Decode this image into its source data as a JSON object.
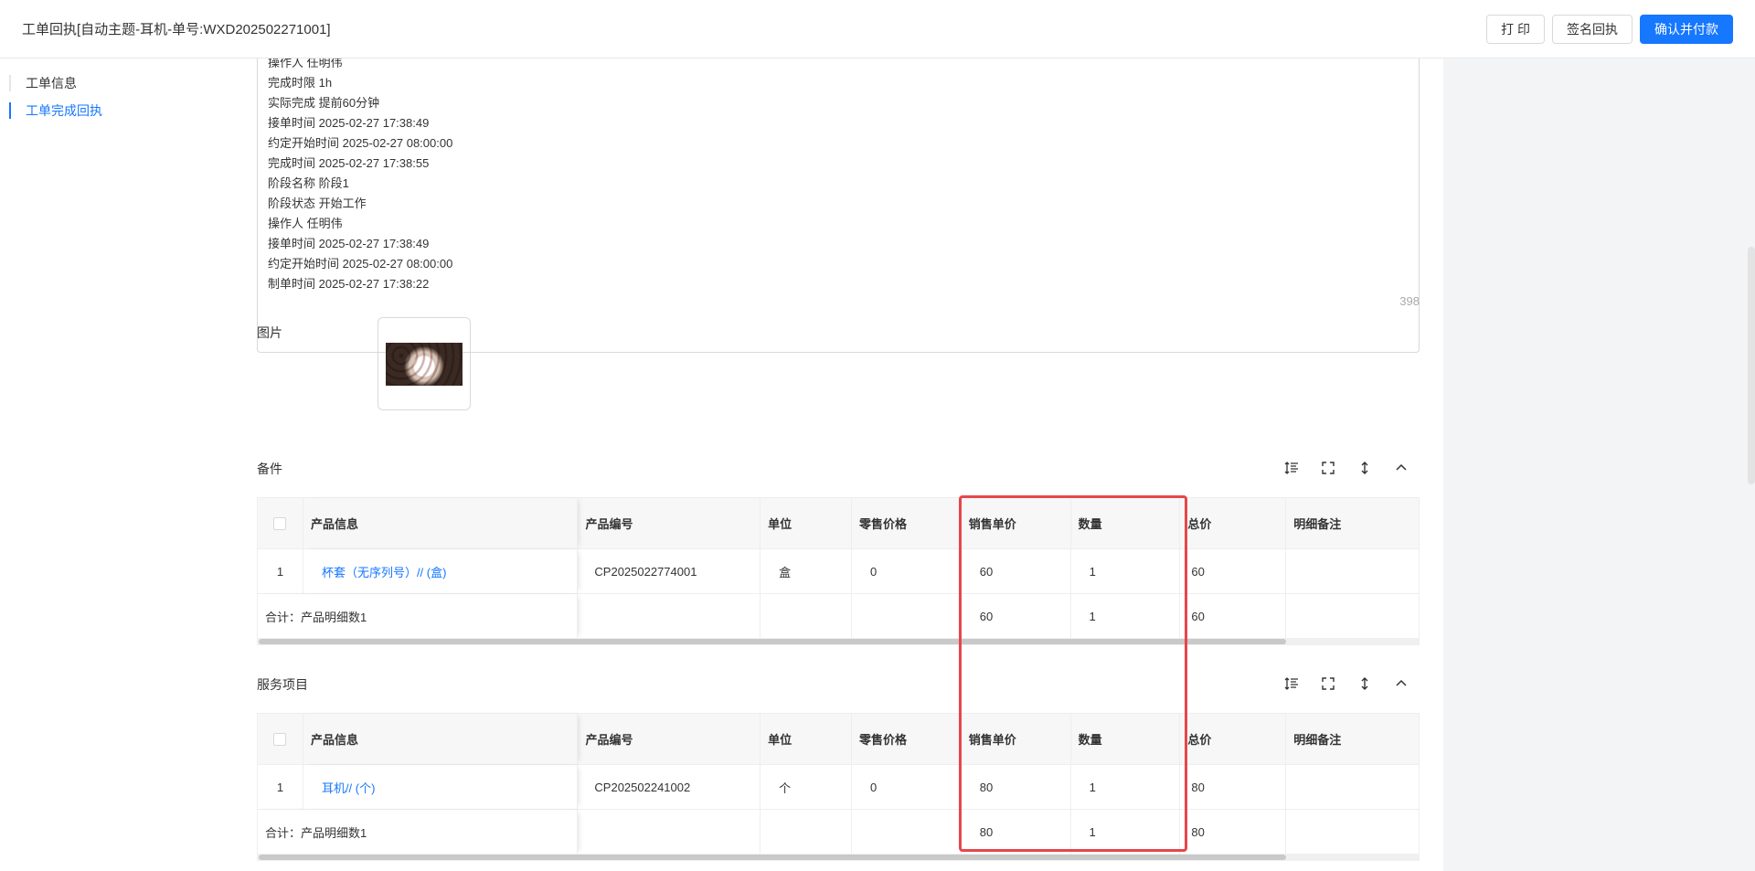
{
  "header": {
    "title": "工单回执[自动主题-耳机-单号:WXD202502271001]",
    "buttons": {
      "print": "打 印",
      "sign": "签名回执",
      "confirm": "确认并付款"
    }
  },
  "sidebar": {
    "items": [
      {
        "label": "工单信息"
      },
      {
        "label": "工单完成回执"
      }
    ]
  },
  "log": {
    "lines": [
      "操作人 任明伟",
      "完成时限 1h",
      "实际完成 提前60分钟",
      "接单时间 2025-02-27 17:38:49",
      "约定开始时间 2025-02-27 08:00:00",
      "完成时间 2025-02-27 17:38:55",
      "阶段名称 阶段1",
      "阶段状态 开始工作",
      "操作人 任明伟",
      "接单时间 2025-02-27 17:38:49",
      "约定开始时间 2025-02-27 08:00:00",
      "制单时间 2025-02-27 17:38:22"
    ],
    "char_count": "398"
  },
  "image": {
    "label": "图片"
  },
  "tables": {
    "headers": {
      "info": "产品信息",
      "code": "产品编号",
      "unit": "单位",
      "retail": "零售价格",
      "price": "销售单价",
      "qty": "数量",
      "total": "总价",
      "note": "明细备注"
    },
    "parts": {
      "title": "备件",
      "rows": [
        {
          "index": "1",
          "name": "杯套（无序列号）// (盒)",
          "code": "CP2025022774001",
          "unit": "盒",
          "retail": "0",
          "price": "60",
          "qty": "1",
          "total": "60",
          "note": ""
        }
      ],
      "summary": {
        "label": "合计：产品明细数1",
        "price": "60",
        "qty": "1",
        "total": "60"
      }
    },
    "services": {
      "title": "服务项目",
      "rows": [
        {
          "index": "1",
          "name": "耳机// (个)",
          "code": "CP202502241002",
          "unit": "个",
          "retail": "0",
          "price": "80",
          "qty": "1",
          "total": "80",
          "note": ""
        }
      ],
      "summary": {
        "label": "合计：产品明细数1",
        "price": "80",
        "qty": "1",
        "total": "80"
      }
    }
  }
}
